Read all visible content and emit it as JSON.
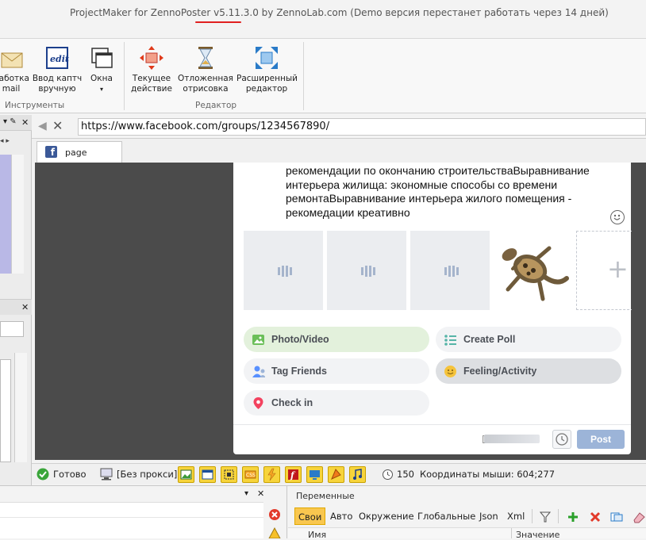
{
  "window": {
    "title": "ProjectMaker for ZennoPoster v5.11.3.0 by ZennoLab.com (Demo версия перестанет работать через 14 дней)"
  },
  "ribbon": {
    "groups": [
      {
        "label": "Инструменты",
        "buttons": [
          {
            "label_1": "работка",
            "label_2": "mail",
            "icon": "email-icon"
          },
          {
            "label_1": "Ввод каптч",
            "label_2": "вручную",
            "icon": "captcha-icon"
          },
          {
            "label_1": "Окна",
            "label_2": "▾",
            "icon": "windows-icon"
          }
        ]
      },
      {
        "label": "Редактор",
        "buttons": [
          {
            "label_1": "Текущее",
            "label_2": "действие",
            "icon": "current-action-icon"
          },
          {
            "label_1": "Отложенная",
            "label_2": "отрисовка",
            "icon": "hourglass-icon"
          },
          {
            "label_1": "Расширенный",
            "label_2": "редактор",
            "icon": "expand-icon"
          }
        ]
      }
    ]
  },
  "browser": {
    "url": "https://www.facebook.com/groups/1234567890/",
    "tab_label": "page",
    "post_text": "рекомендации по окончанию строительстваВыравнивание интерьера жилища: экономные способы со времени ремонтаВыравнивание интерьера жилого помещения - рекомедации креативно",
    "actions": [
      {
        "label": "Photo/Video",
        "icon": "photo-icon"
      },
      {
        "label": "Create Poll",
        "icon": "poll-icon"
      },
      {
        "label": "Tag Friends",
        "icon": "tag-friends-icon"
      },
      {
        "label": "Feeling/Activity",
        "icon": "feeling-icon"
      },
      {
        "label": "Check in",
        "icon": "location-pin-icon"
      }
    ],
    "post_button": "Post"
  },
  "statusbar": {
    "ready": "Готово",
    "proxy": "[Без прокси]",
    "timeout": "150",
    "coords": "Координаты мыши: 604;277"
  },
  "variables": {
    "title": "Переменные",
    "tabs": [
      "Свои",
      "Авто",
      "Окружение",
      "Глобальные",
      "Json",
      "Xml"
    ],
    "columns": [
      "Имя",
      "Значение"
    ]
  },
  "colors": {
    "facebook_blue": "#3b5998",
    "post_button": "#9cb4d8",
    "photo_pill": "#e3f1dc",
    "feeling_pill": "#dddfe2",
    "active_tab": "#f9c74f"
  }
}
